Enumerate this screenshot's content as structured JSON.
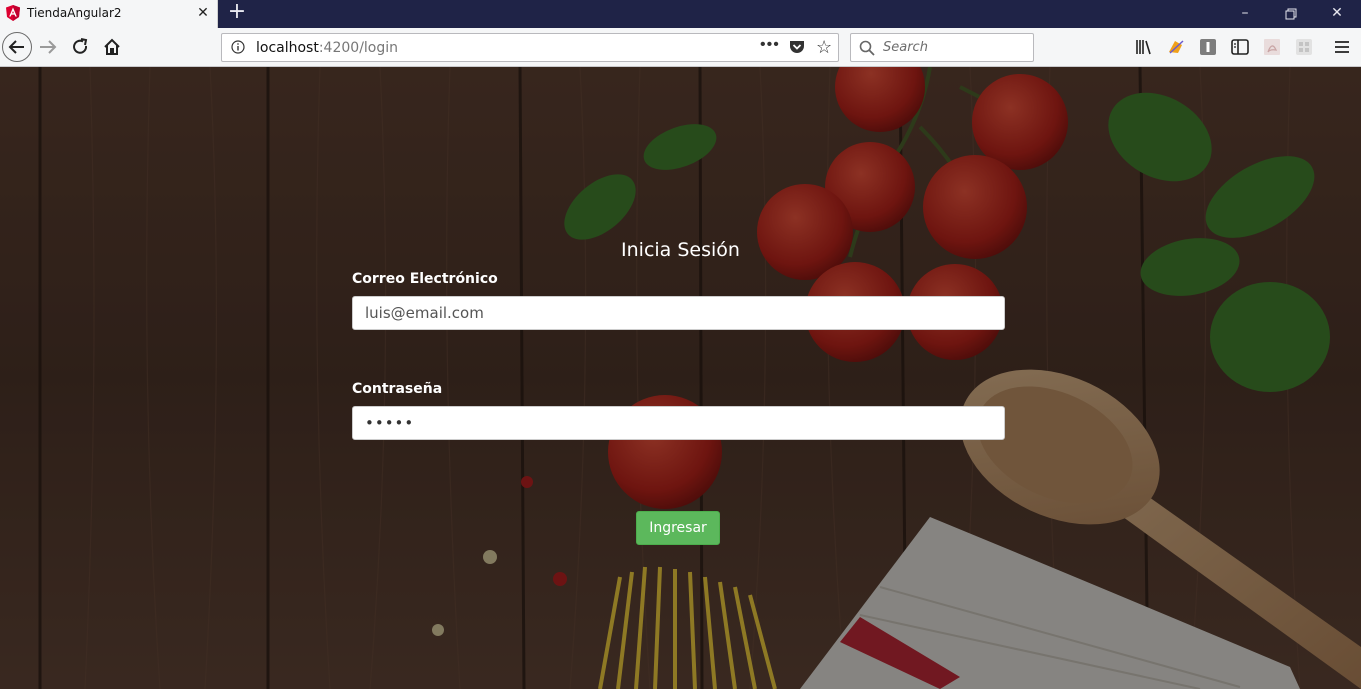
{
  "browser": {
    "tab_title": "TiendaAngular2",
    "url_host": "localhost",
    "url_path": ":4200/login",
    "search_placeholder": "Search",
    "colors": {
      "titlebar": "#1f2347",
      "toolbar": "#f5f6f7"
    }
  },
  "login": {
    "title": "Inicia Sesión",
    "email_label": "Correo Electrónico",
    "email_value": "luis@email.com",
    "password_label": "Contraseña",
    "password_value": "•••••",
    "submit_label": "Ingresar",
    "colors": {
      "submit": "#5cb85c"
    }
  }
}
